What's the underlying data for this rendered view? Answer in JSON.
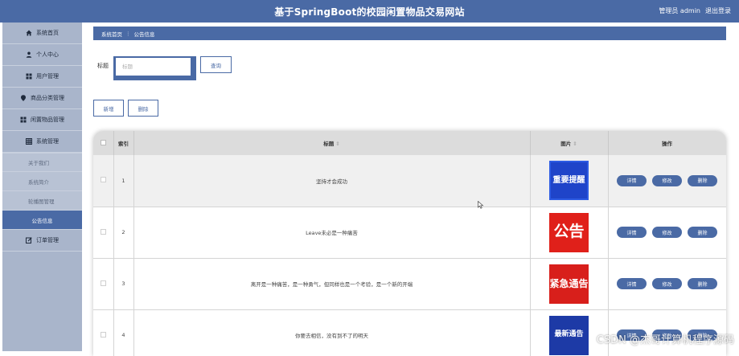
{
  "header": {
    "title": "基于SpringBoot的校园闲置物品交易网站",
    "user_label": "管理员 admin",
    "logout_label": "退出登录"
  },
  "sidebar": {
    "items": [
      {
        "label": "系统首页",
        "icon": "home-icon"
      },
      {
        "label": "个人中心",
        "icon": "user-icon"
      },
      {
        "label": "用户管理",
        "icon": "grid-icon"
      },
      {
        "label": "商品分类管理",
        "icon": "pin-icon"
      },
      {
        "label": "闲置物品管理",
        "icon": "grid-icon"
      },
      {
        "label": "系统管理",
        "icon": "table-icon"
      }
    ],
    "sub_items": [
      {
        "label": "关于我们",
        "active": false
      },
      {
        "label": "系统简介",
        "active": false
      },
      {
        "label": "轮播图管理",
        "active": false
      },
      {
        "label": "公告信息",
        "active": true
      }
    ],
    "bottom_item": {
      "label": "订单管理",
      "icon": "edit-icon"
    }
  },
  "breadcrumb": {
    "home": "系统首页",
    "current": "公告信息"
  },
  "search": {
    "label": "标题",
    "placeholder": "标题",
    "button": "查询"
  },
  "actions": {
    "add": "新增",
    "delete": "删除"
  },
  "table": {
    "headers": [
      "索引",
      "标题",
      "图片",
      "操作"
    ],
    "rows": [
      {
        "index": "1",
        "title": "坚持才会成功",
        "image_text": "重要提醒"
      },
      {
        "index": "2",
        "title": "Leave未必是一种痛苦",
        "image_text": "公告"
      },
      {
        "index": "3",
        "title": "离开是一种痛苦，是一种勇气，但同样也是一个考验，是一个新的开端",
        "image_text": "紧急通告"
      },
      {
        "index": "4",
        "title": "你要去相信，没有到不了的明天",
        "image_text": "最新通告"
      }
    ],
    "ops": {
      "detail": "详情",
      "edit": "修改",
      "delete": "删除"
    }
  },
  "watermark": "CSDN @杰哥计算机程序源码",
  "colors": {
    "primary": "#4a6aa5",
    "sidebar": "#a9b5cb"
  }
}
